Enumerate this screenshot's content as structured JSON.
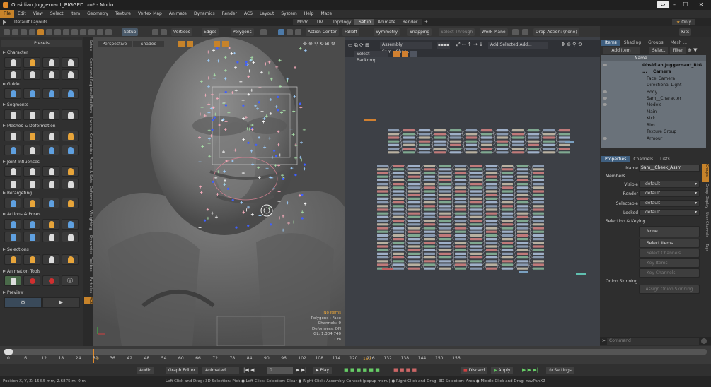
{
  "window": {
    "title": "Obsidian Juggernaut_RIGGED.lxo* - Modo"
  },
  "menu": [
    "File",
    "Edit",
    "View",
    "Select",
    "Item",
    "Geometry",
    "Texture",
    "Vertex Map",
    "Animate",
    "Dynamics",
    "Render",
    "ACS",
    "Layout",
    "System",
    "Help",
    "Maze"
  ],
  "layout": {
    "default_label": "Default Layouts",
    "tabs": [
      "Modo",
      "UV",
      "Topology",
      "Setup",
      "Animate",
      "Render"
    ],
    "active_tab": "Setup",
    "add_tab": "+",
    "only_label": "Only"
  },
  "toolbar": {
    "setup": "Setup",
    "vertices": "Vertices",
    "edges": "Edges",
    "polygons": "Polygons",
    "action_center": "Action Center",
    "falloff": "Falloff",
    "symmetry": "Symmetry",
    "snapping": "Snapping",
    "select_through": "Select Through",
    "work_plane": "Work Plane",
    "drop_action": "Drop Action: (none)",
    "kits": "Kits"
  },
  "left_panel": {
    "presets": "Presets",
    "sections": [
      "Character",
      "Guide",
      "Segments",
      "Meshes & Deformation",
      "Joint Influences",
      "Retargeting",
      "Actions & Poses",
      "Selections",
      "Animation Tools",
      "Preview"
    ]
  },
  "vertical_tabs": [
    "Setup",
    "Command Regions",
    "Modifiers",
    "Inverse Kinematics",
    "Actors & Sets",
    "Deformers",
    "Weighting",
    "Dynamics",
    "Toolbox",
    "Particles",
    "ACS"
  ],
  "viewport": {
    "perspective": "Perspective",
    "shaded": "Shaded",
    "info": [
      "No Items",
      "Polygons : Face",
      "Channels: 0",
      "Deformers: ON",
      "GL: 1,304,740",
      "1 m"
    ]
  },
  "schematic": {
    "assembly": "Assembly: Sam__Chee...",
    "select_backdrop": "Select Backdrop",
    "add_selected": "Add Selected",
    "add": "Add..."
  },
  "items_panel": {
    "tabs": [
      "Items",
      "Shading",
      "Groups",
      "Mesh ..."
    ],
    "add_item": "Add Item",
    "select": "Select",
    "filter": "Filter",
    "col_name": "Name",
    "items": [
      "Obsidian Juggernaut_RIG ...",
      "Camera",
      "Face_Camera",
      "Directional Light",
      "Body",
      "Sam__Character",
      "Models",
      "Main",
      "Kick",
      "Rim",
      "Texture Group",
      "Armour"
    ]
  },
  "properties": {
    "tabs": [
      "Properties",
      "Channels",
      "Lists"
    ],
    "name_label": "Name",
    "name_value": "Sam__Cheek_Assm",
    "members": "Members",
    "fields": [
      {
        "label": "Visible",
        "value": "default"
      },
      {
        "label": "Render",
        "value": "default"
      },
      {
        "label": "Selectable",
        "value": "default"
      },
      {
        "label": "Locked",
        "value": "default"
      }
    ],
    "selection_keying": "Selection & Keying",
    "none": "None",
    "select_items": "Select Items",
    "select_channels": "Select Channels",
    "key_items": "Key Items",
    "key_channels": "Key Channels",
    "onion": "Onion Skinning",
    "assign_onion": "Assign Onion Skinning",
    "side_tabs": [
      "Groups",
      "Group Display",
      "User Channels",
      "Tags"
    ],
    "command": "Command"
  },
  "timeline": {
    "ticks": [
      "0",
      "6",
      "12",
      "18",
      "24",
      "30",
      "36",
      "42",
      "48",
      "54",
      "60",
      "66",
      "72",
      "78",
      "84",
      "90",
      "96",
      "102",
      "108",
      "114",
      "120",
      "126",
      "132",
      "138",
      "144",
      "150",
      "156"
    ],
    "marker_start": "0",
    "marker_end": "160"
  },
  "bottom": {
    "audio": "Audio",
    "graph_editor": "Graph Editor",
    "animated": "Animated",
    "frame": "0",
    "play": "Play",
    "discard": "Discard",
    "apply": "Apply",
    "settings": "Settings"
  },
  "status": {
    "position": "Position X, Y, Z:   158.5 mm, 2.6875 m, 0 m",
    "hint": "Left Click and Drag: 3D Selection: Pick ● Left Click: Selection: Clear ● Right Click: Assembly Context (popup menu) ● Right Click and Drag: 3D Selection: Area ● Middle Click and Drag: navPanXZ"
  }
}
